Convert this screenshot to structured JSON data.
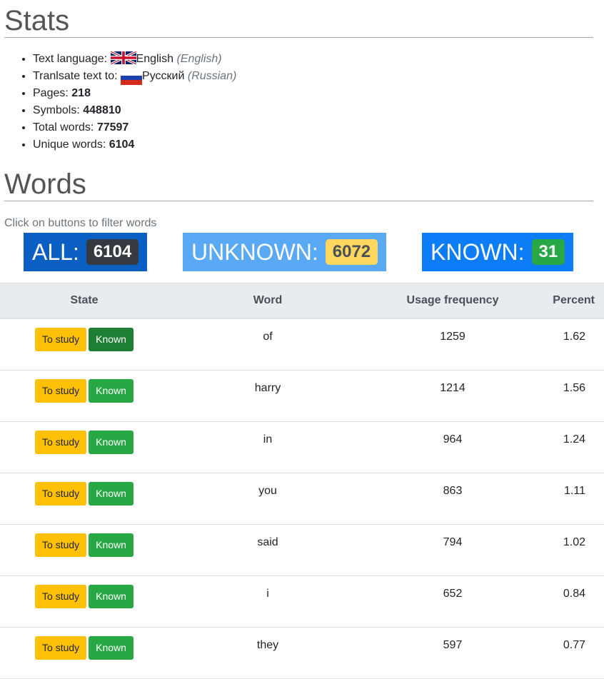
{
  "stats": {
    "heading": "Stats",
    "items": [
      {
        "label": "Text language: ",
        "value": "English",
        "note": "(English)",
        "flag": "uk-flag-icon"
      },
      {
        "label": "Tranlsate text to: ",
        "value": "Русский",
        "note": "(Russian)",
        "flag": "russia-flag-icon"
      },
      {
        "label": "Pages: ",
        "value": "218"
      },
      {
        "label": "Symbols: ",
        "value": "448810"
      },
      {
        "label": "Total words: ",
        "value": "77597"
      },
      {
        "label": "Unique words: ",
        "value": "6104"
      }
    ]
  },
  "words": {
    "heading": "Words",
    "hint": "Click on buttons to filter words",
    "filters": [
      {
        "label": "ALL:",
        "count": "6104",
        "bg": "#0b5ec2",
        "badge_bg": "#343a40",
        "badge_fg": "#ffffff"
      },
      {
        "label": "UNKNOWN:",
        "count": "6072",
        "bg": "#5aa9f4",
        "badge_bg": "#ffd75e",
        "badge_fg": "#495057"
      },
      {
        "label": "KNOWN:",
        "count": "31",
        "bg": "#0d7df7",
        "badge_bg": "#28a745",
        "badge_fg": "#ffffff"
      }
    ],
    "columns": [
      "State",
      "Word",
      "Usage frequency",
      "Percent"
    ],
    "to_study_label": "To study",
    "known_label": "Known",
    "rows": [
      {
        "word": "of",
        "freq": "1259",
        "pct": "1.62"
      },
      {
        "word": "harry",
        "freq": "1214",
        "pct": "1.56"
      },
      {
        "word": "in",
        "freq": "964",
        "pct": "1.24"
      },
      {
        "word": "you",
        "freq": "863",
        "pct": "1.11"
      },
      {
        "word": "said",
        "freq": "794",
        "pct": "1.02"
      },
      {
        "word": "i",
        "freq": "652",
        "pct": "0.84"
      },
      {
        "word": "they",
        "freq": "597",
        "pct": "0.77"
      }
    ]
  }
}
